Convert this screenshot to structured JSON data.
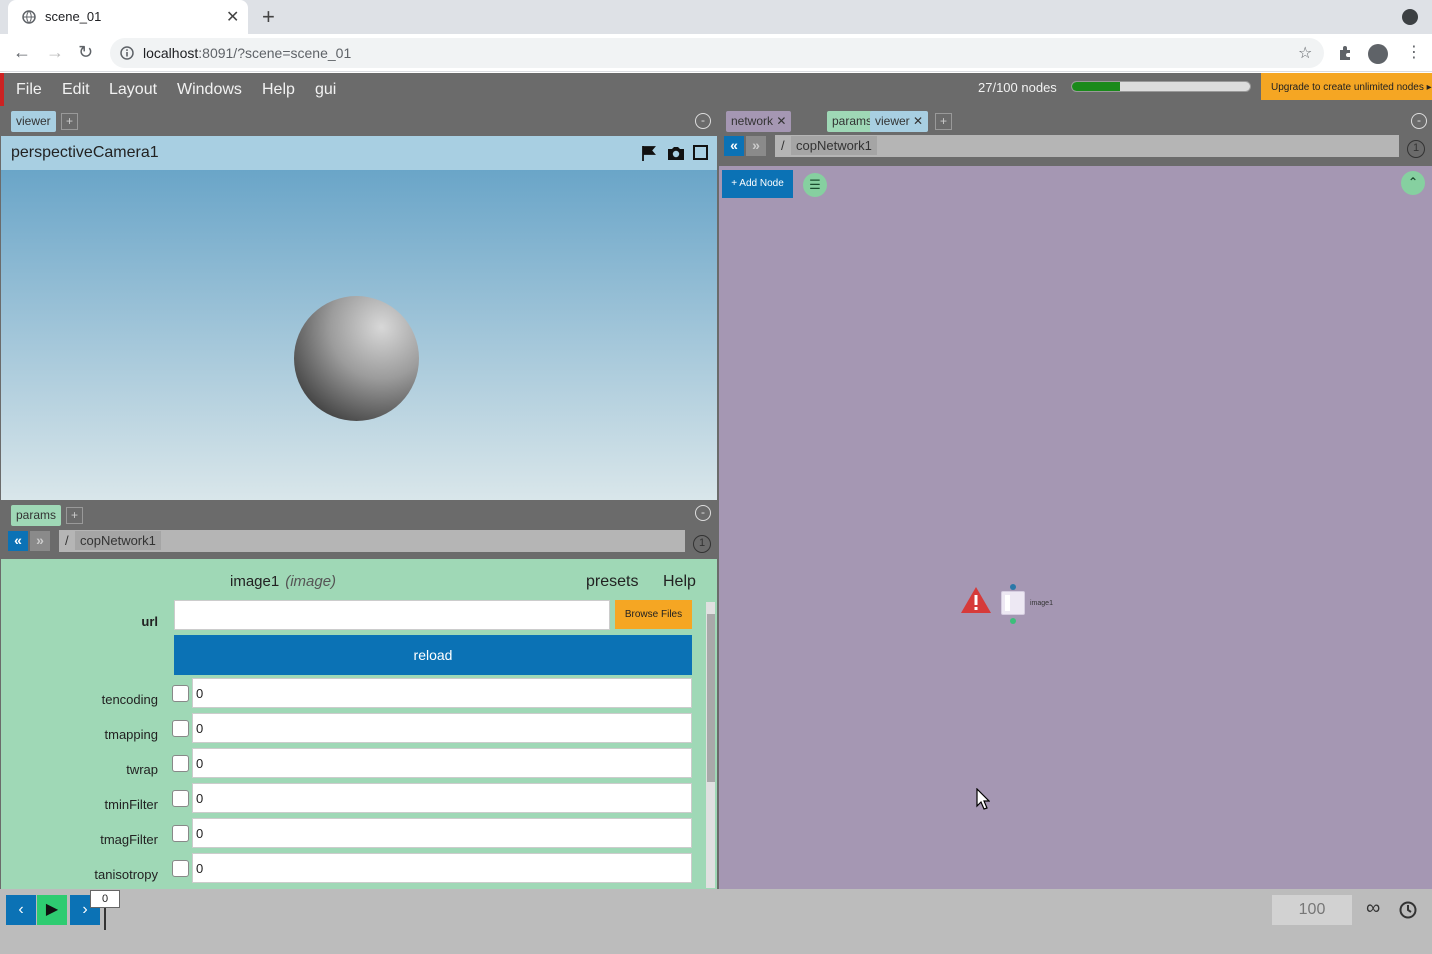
{
  "browser": {
    "tab_title": "scene_01",
    "url_host": "localhost",
    "url_rest": ":8091/?scene=scene_01"
  },
  "menu": {
    "items": [
      "File",
      "Edit",
      "Layout",
      "Windows",
      "Help",
      "gui"
    ]
  },
  "status": {
    "node_count": "27/100 nodes",
    "progress": 0.27,
    "upgrade": "Upgrade to create unlimited nodes ▸"
  },
  "viewer": {
    "tab": "viewer",
    "camera": "perspectiveCamera1"
  },
  "params": {
    "tab": "params",
    "path_root": "/",
    "path_node": "copNetwork1",
    "badge": "1",
    "node_name": "image1",
    "node_type": "(image)",
    "presets": "presets",
    "help": "Help",
    "url_label": "url",
    "url_value": "",
    "browse": "Browse Files",
    "reload": "reload",
    "fields": [
      {
        "label": "tencoding",
        "value": "0"
      },
      {
        "label": "tmapping",
        "value": "0"
      },
      {
        "label": "twrap",
        "value": "0"
      },
      {
        "label": "tminFilter",
        "value": "0"
      },
      {
        "label": "tmagFilter",
        "value": "0"
      },
      {
        "label": "tanisotropy",
        "value": "0"
      }
    ]
  },
  "network": {
    "tabs": [
      "network",
      "params",
      "viewer"
    ],
    "path_root": "/",
    "path_node": "copNetwork1",
    "badge": "1",
    "add_node": "+ Add Node",
    "node_label": "image1"
  },
  "timeline": {
    "frame": "0",
    "end_frame": "100"
  },
  "colors": {
    "accent_blue": "#0b72b5",
    "accent_orange": "#f5a623",
    "params_bg": "#9fd8b6",
    "network_bg": "#a597b3"
  }
}
